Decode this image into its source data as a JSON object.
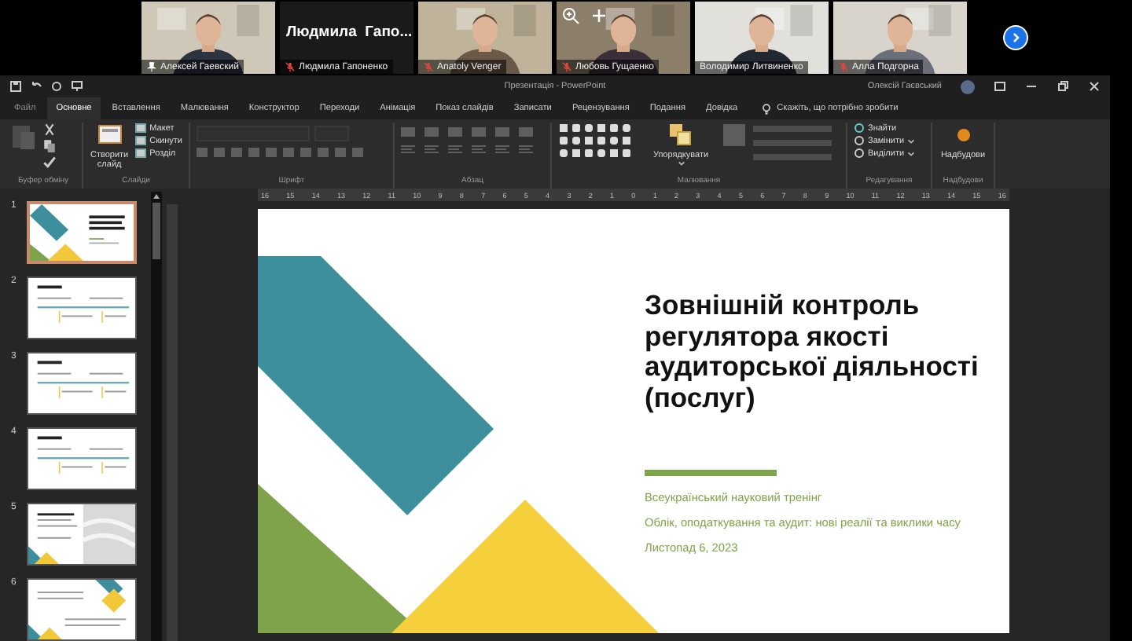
{
  "call": {
    "participants": [
      {
        "kind": "video",
        "name": "Алексей Гаевский",
        "pinned": true,
        "muted": false
      },
      {
        "kind": "name",
        "caption": "Людмила  Гапо...",
        "name": "Людмила Гапоненко",
        "pinned": false,
        "muted": true
      },
      {
        "kind": "video",
        "name": "Anatoly Venger",
        "pinned": false,
        "muted": true
      },
      {
        "kind": "video",
        "name": "Любовь Гущаенко",
        "pinned": false,
        "muted": true,
        "zoom_controls": true
      },
      {
        "kind": "video",
        "name": "Володимир Литвиненко",
        "pinned": false,
        "muted": false
      },
      {
        "kind": "video",
        "name": "Алла Подгорна",
        "pinned": false,
        "muted": true
      }
    ]
  },
  "powerpoint": {
    "title": "Презентація - PowerPoint",
    "user": "Олексій Гаєвський",
    "tabs": [
      {
        "label": "Файл",
        "selected": false
      },
      {
        "label": "Основне",
        "selected": true
      },
      {
        "label": "Вставлення",
        "selected": false
      },
      {
        "label": "Малювання",
        "selected": false
      },
      {
        "label": "Конструктор",
        "selected": false
      },
      {
        "label": "Переходи",
        "selected": false
      },
      {
        "label": "Анімація",
        "selected": false
      },
      {
        "label": "Показ слайдів",
        "selected": false
      },
      {
        "label": "Записати",
        "selected": false
      },
      {
        "label": "Рецензування",
        "selected": false
      },
      {
        "label": "Подання",
        "selected": false
      },
      {
        "label": "Довідка",
        "selected": false
      }
    ],
    "search": {
      "placeholder": "Скажіть, що потрібно зробити"
    },
    "ribbon": [
      {
        "kind": "clipboard",
        "label": "Буфер обміну"
      },
      {
        "kind": "slides",
        "label": "Слайди",
        "large": "Створити слайд",
        "commands": [
          "Макет",
          "Скинути",
          "Розділ"
        ]
      },
      {
        "kind": "font",
        "label": "Шрифт"
      },
      {
        "kind": "paragraph",
        "label": "Абзац"
      },
      {
        "kind": "drawing",
        "label": "Малювання",
        "large": "Упорядкувати"
      },
      {
        "kind": "editing",
        "label": "Редагування",
        "commands": [
          "Знайти",
          "Замінити",
          "Виділити"
        ]
      },
      {
        "kind": "addins",
        "label": "Надбудови",
        "large": "Надбудови"
      }
    ],
    "slides": [
      {
        "number": "1",
        "selected": true
      },
      {
        "number": "2",
        "selected": false
      },
      {
        "number": "3",
        "selected": false
      },
      {
        "number": "4",
        "selected": false
      },
      {
        "number": "5",
        "selected": false
      },
      {
        "number": "6",
        "selected": false
      }
    ],
    "ruler": [
      "16",
      "15",
      "14",
      "13",
      "12",
      "11",
      "10",
      "9",
      "8",
      "7",
      "6",
      "5",
      "4",
      "3",
      "2",
      "1",
      "0",
      "1",
      "2",
      "3",
      "4",
      "5",
      "6",
      "7",
      "8",
      "9",
      "10",
      "11",
      "12",
      "13",
      "14",
      "15",
      "16"
    ],
    "slide": {
      "title": "Зовнішній контроль регулятора якості аудиторської діяльності (послуг)",
      "lines": [
        "Всеукраїнський науковий тренінг",
        "Облік, оподаткування та аудит: нові реалії та виклики часу",
        "Листопад 6, 2023"
      ]
    }
  }
}
